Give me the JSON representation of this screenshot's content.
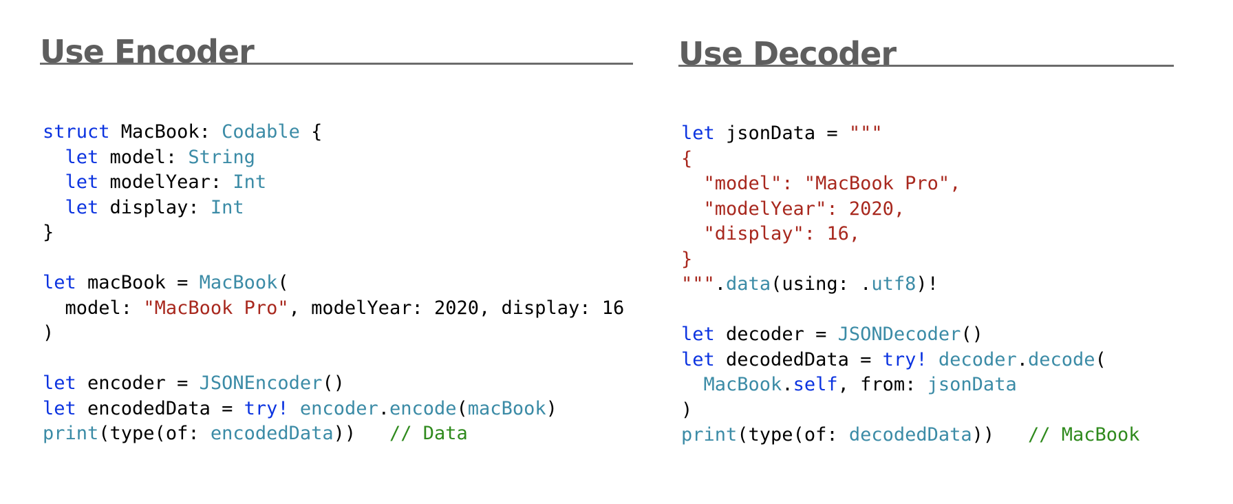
{
  "colors": {
    "plain": "#000000",
    "keyword": "#0b33e0",
    "type": "#3b8ba6",
    "string": "#a8281e",
    "comment": "#2f8a1d",
    "title": "#5e5e5e"
  },
  "encoder": {
    "title": "Use Encoder",
    "lines": [
      [
        [
          "kw",
          "struct"
        ],
        [
          "plain",
          " MacBook: "
        ],
        [
          "type",
          "Codable"
        ],
        [
          "plain",
          " {"
        ]
      ],
      [
        [
          "plain",
          "  "
        ],
        [
          "kw",
          "let"
        ],
        [
          "plain",
          " model: "
        ],
        [
          "type",
          "String"
        ]
      ],
      [
        [
          "plain",
          "  "
        ],
        [
          "kw",
          "let"
        ],
        [
          "plain",
          " modelYear: "
        ],
        [
          "type",
          "Int"
        ]
      ],
      [
        [
          "plain",
          "  "
        ],
        [
          "kw",
          "let"
        ],
        [
          "plain",
          " display: "
        ],
        [
          "type",
          "Int"
        ]
      ],
      [
        [
          "plain",
          "}"
        ]
      ],
      [],
      [
        [
          "kw",
          "let"
        ],
        [
          "plain",
          " macBook = "
        ],
        [
          "type",
          "MacBook"
        ],
        [
          "plain",
          "("
        ]
      ],
      [
        [
          "plain",
          "  model: "
        ],
        [
          "str",
          "\"MacBook Pro\""
        ],
        [
          "plain",
          ", modelYear: 2020, display: 16"
        ]
      ],
      [
        [
          "plain",
          ")"
        ]
      ],
      [],
      [
        [
          "kw",
          "let"
        ],
        [
          "plain",
          " encoder = "
        ],
        [
          "type",
          "JSONEncoder"
        ],
        [
          "plain",
          "()"
        ]
      ],
      [
        [
          "kw",
          "let"
        ],
        [
          "plain",
          " encodedData = "
        ],
        [
          "kw",
          "try!"
        ],
        [
          "plain",
          " "
        ],
        [
          "type",
          "encoder"
        ],
        [
          "plain",
          "."
        ],
        [
          "type",
          "encode"
        ],
        [
          "plain",
          "("
        ],
        [
          "type",
          "macBook"
        ],
        [
          "plain",
          ")"
        ]
      ],
      [
        [
          "type",
          "print"
        ],
        [
          "plain",
          "(type(of: "
        ],
        [
          "type",
          "encodedData"
        ],
        [
          "plain",
          "))   "
        ],
        [
          "cmt",
          "// Data"
        ]
      ]
    ]
  },
  "decoder": {
    "title": "Use Decoder",
    "lines": [
      [
        [
          "kw",
          "let"
        ],
        [
          "plain",
          " jsonData = "
        ],
        [
          "str",
          "\"\"\""
        ]
      ],
      [
        [
          "str",
          "{"
        ]
      ],
      [
        [
          "str",
          "  \"model\": \"MacBook Pro\","
        ]
      ],
      [
        [
          "str",
          "  \"modelYear\": 2020,"
        ]
      ],
      [
        [
          "str",
          "  \"display\": 16,"
        ]
      ],
      [
        [
          "str",
          "}"
        ]
      ],
      [
        [
          "str",
          "\"\"\""
        ],
        [
          "plain",
          "."
        ],
        [
          "type",
          "data"
        ],
        [
          "plain",
          "(using: ."
        ],
        [
          "type",
          "utf8"
        ],
        [
          "plain",
          ")!"
        ]
      ],
      [],
      [
        [
          "kw",
          "let"
        ],
        [
          "plain",
          " decoder = "
        ],
        [
          "type",
          "JSONDecoder"
        ],
        [
          "plain",
          "()"
        ]
      ],
      [
        [
          "kw",
          "let"
        ],
        [
          "plain",
          " decodedData = "
        ],
        [
          "kw",
          "try!"
        ],
        [
          "plain",
          " "
        ],
        [
          "type",
          "decoder"
        ],
        [
          "plain",
          "."
        ],
        [
          "type",
          "decode"
        ],
        [
          "plain",
          "("
        ]
      ],
      [
        [
          "plain",
          "  "
        ],
        [
          "type",
          "MacBook"
        ],
        [
          "plain",
          "."
        ],
        [
          "kw",
          "self"
        ],
        [
          "plain",
          ", from: "
        ],
        [
          "type",
          "jsonData"
        ]
      ],
      [
        [
          "plain",
          ")"
        ]
      ],
      [
        [
          "type",
          "print"
        ],
        [
          "plain",
          "(type(of: "
        ],
        [
          "type",
          "decodedData"
        ],
        [
          "plain",
          "))   "
        ],
        [
          "cmt",
          "// MacBook"
        ]
      ]
    ]
  }
}
